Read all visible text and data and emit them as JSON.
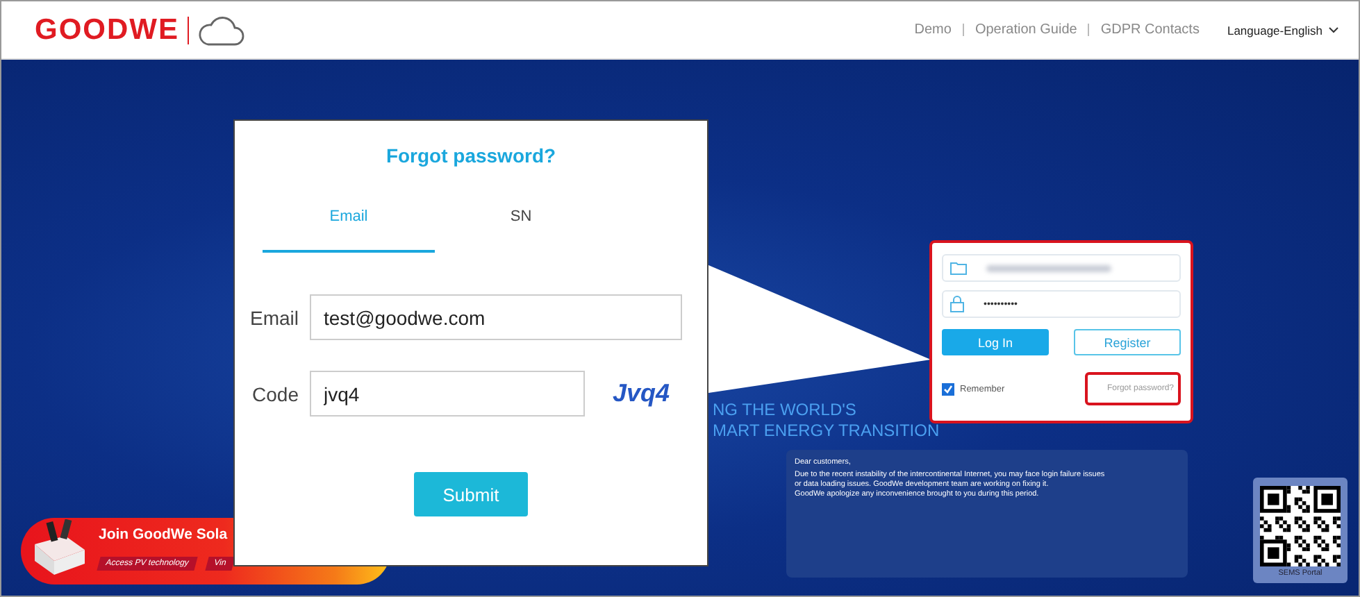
{
  "header": {
    "logo": "GOODWE",
    "nav_links": [
      "Demo",
      "Operation Guide",
      "GDPR Contacts"
    ],
    "language": "Language-English"
  },
  "tagline": [
    "NG THE WORLD'S",
    "MART ENERGY TRANSITION"
  ],
  "login": {
    "password_value": "••••••••••",
    "login_button": "Log In",
    "register_button": "Register",
    "remember": {
      "label": "Remember",
      "checked": true
    },
    "forgot_link": "Forgot password?"
  },
  "notice": {
    "greeting": "Dear customers,",
    "lines": [
      "Due to the recent instability of the intercontinental Internet, you may face login failure issues",
      "or data loading issues. GoodWe development team are working on fixing it.",
      "GoodWe apologize any inconvenience brought to you during this period."
    ]
  },
  "qr": {
    "caption": "SEMS Portal"
  },
  "banner": {
    "title": "Join GoodWe Sola",
    "tags": [
      "Access PV technology",
      "Vin"
    ]
  },
  "popup": {
    "title": "Forgot password?",
    "tabs": [
      {
        "label": "Email",
        "selected": true
      },
      {
        "label": "SN",
        "selected": false
      }
    ],
    "fields": [
      {
        "kind": "text",
        "label": "Email",
        "value": "test@goodwe.com"
      },
      {
        "kind": "captcha",
        "label": "Code",
        "value": "jvq4",
        "captcha": "Jvq4"
      }
    ],
    "submit": "Submit"
  }
}
